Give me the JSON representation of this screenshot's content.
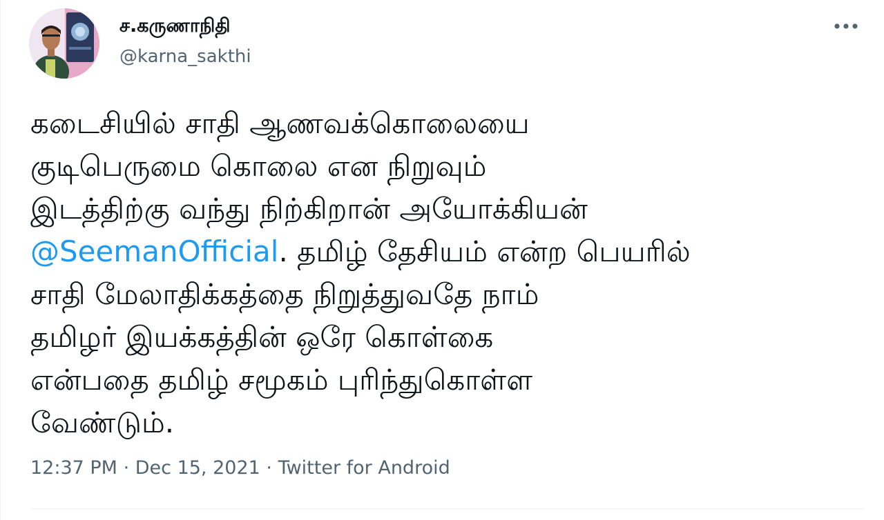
{
  "author": {
    "name": "ச.கருணாநிதி",
    "handle": "@karna_sakthi"
  },
  "tweet": {
    "lines": [
      {
        "text": "கடைசியில் சாதி ஆணவக்கொலையை"
      },
      {
        "text": "குடிபெருமை கொலை என நிறுவும்"
      },
      {
        "text": "இடத்திற்கு வந்து நிற்கிறான் அயோக்கியன்"
      },
      {
        "mention": "@SeemanOfficial",
        "text": ". தமிழ் தேசியம் என்ற பெயரில்"
      },
      {
        "text": "சாதி மேலாதிக்கத்தை நிறுத்துவதே நாம்"
      },
      {
        "text": "தமிழர் இயக்கத்தின் ஒரே கொள்கை"
      },
      {
        "text": "என்பதை தமிழ் சமூகம் புரிந்துகொள்ள"
      },
      {
        "text": "வேண்டும்."
      }
    ]
  },
  "meta": {
    "time": "12:37 PM",
    "separator": " · ",
    "date": "Dec 15, 2021",
    "source": "Twitter for Android"
  },
  "icons": {
    "more": "more-horizontal-icon"
  },
  "colors": {
    "text": "#0f1419",
    "secondary": "#536471",
    "link": "#1d9bf0",
    "divider": "#eff3f4"
  }
}
